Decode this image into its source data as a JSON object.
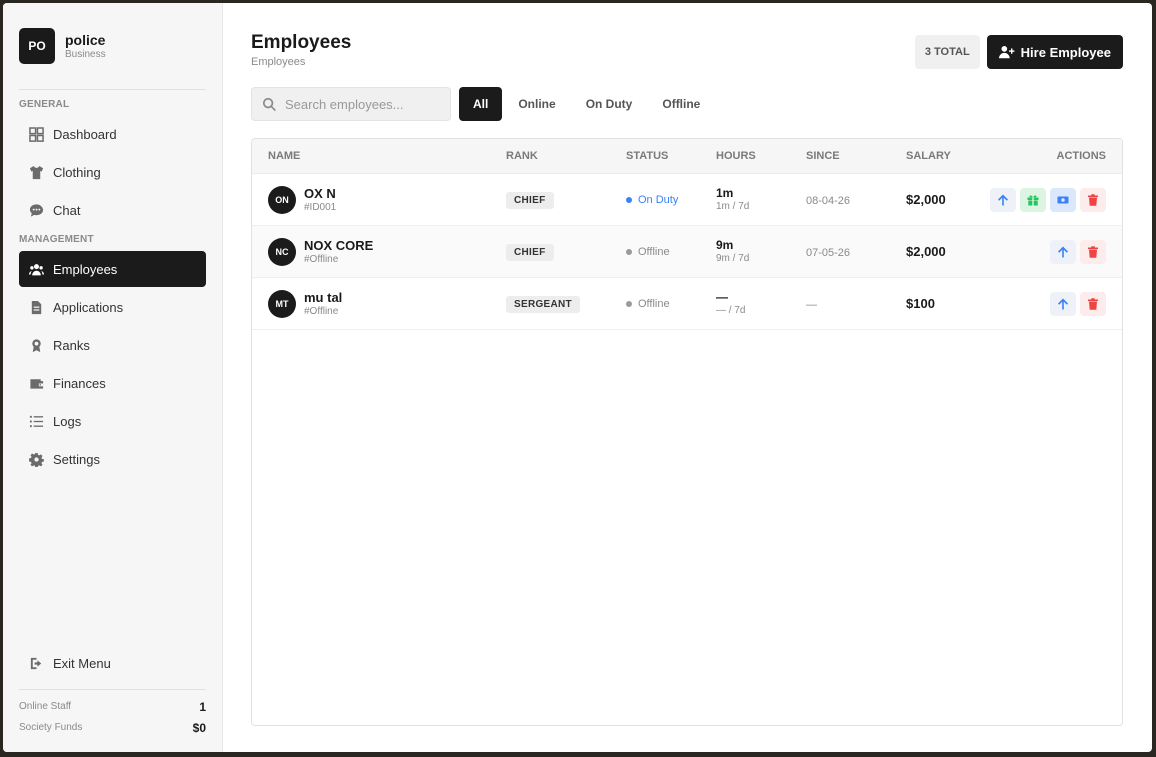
{
  "brand": {
    "initials": "PO",
    "name": "police",
    "type": "Business"
  },
  "sidebar": {
    "general_label": "GENERAL",
    "management_label": "MANAGEMENT",
    "general_items": [
      {
        "label": "Dashboard",
        "icon": "dashboard-icon"
      },
      {
        "label": "Clothing",
        "icon": "shirt-icon"
      },
      {
        "label": "Chat",
        "icon": "chat-icon"
      }
    ],
    "management_items": [
      {
        "label": "Employees",
        "icon": "users-icon",
        "active": true
      },
      {
        "label": "Applications",
        "icon": "file-icon"
      },
      {
        "label": "Ranks",
        "icon": "award-icon"
      },
      {
        "label": "Finances",
        "icon": "wallet-icon"
      },
      {
        "label": "Logs",
        "icon": "list-icon"
      },
      {
        "label": "Settings",
        "icon": "gear-icon"
      }
    ],
    "exit_label": "Exit Menu",
    "stats": [
      {
        "label": "Online Staff",
        "value": "1"
      },
      {
        "label": "Society Funds",
        "value": "$0"
      }
    ]
  },
  "header": {
    "title": "Employees",
    "subtitle": "Employees",
    "total_badge": "3 TOTAL",
    "hire_label": "Hire Employee"
  },
  "search": {
    "placeholder": "Search employees...",
    "value": ""
  },
  "filters": [
    {
      "label": "All",
      "active": true
    },
    {
      "label": "Online"
    },
    {
      "label": "On Duty"
    },
    {
      "label": "Offline"
    }
  ],
  "table": {
    "columns": [
      "NAME",
      "RANK",
      "STATUS",
      "HOURS",
      "SINCE",
      "SALARY",
      "ACTIONS"
    ],
    "rows": [
      {
        "initials": "ON",
        "name": "OX N",
        "id": "#ID001",
        "rank": "CHIEF",
        "status": "On Duty",
        "hours": "1m",
        "hours_sub": "1m / 7d",
        "since": "08-04-26",
        "salary": "$2,000",
        "actions": [
          "promote",
          "gift",
          "pay",
          "fire"
        ]
      },
      {
        "initials": "NC",
        "name": "NOX CORE",
        "id": "#Offline",
        "rank": "CHIEF",
        "status": "Offline",
        "hours": "9m",
        "hours_sub": "9m / 7d",
        "since": "07-05-26",
        "salary": "$2,000",
        "actions": [
          "promote",
          "fire"
        ]
      },
      {
        "initials": "MT",
        "name": "mu tal",
        "id": "#Offline",
        "rank": "SERGEANT",
        "status": "Offline",
        "hours": "—",
        "hours_sub": "— / 7d",
        "since": "—",
        "salary": "$100",
        "actions": [
          "promote",
          "fire"
        ]
      }
    ]
  },
  "colors": {
    "accent_dark": "#1b1b1b",
    "on_duty": "#3b82f6",
    "offline": "#9a9a9a",
    "danger": "#ef4444",
    "success": "#22c55e"
  }
}
